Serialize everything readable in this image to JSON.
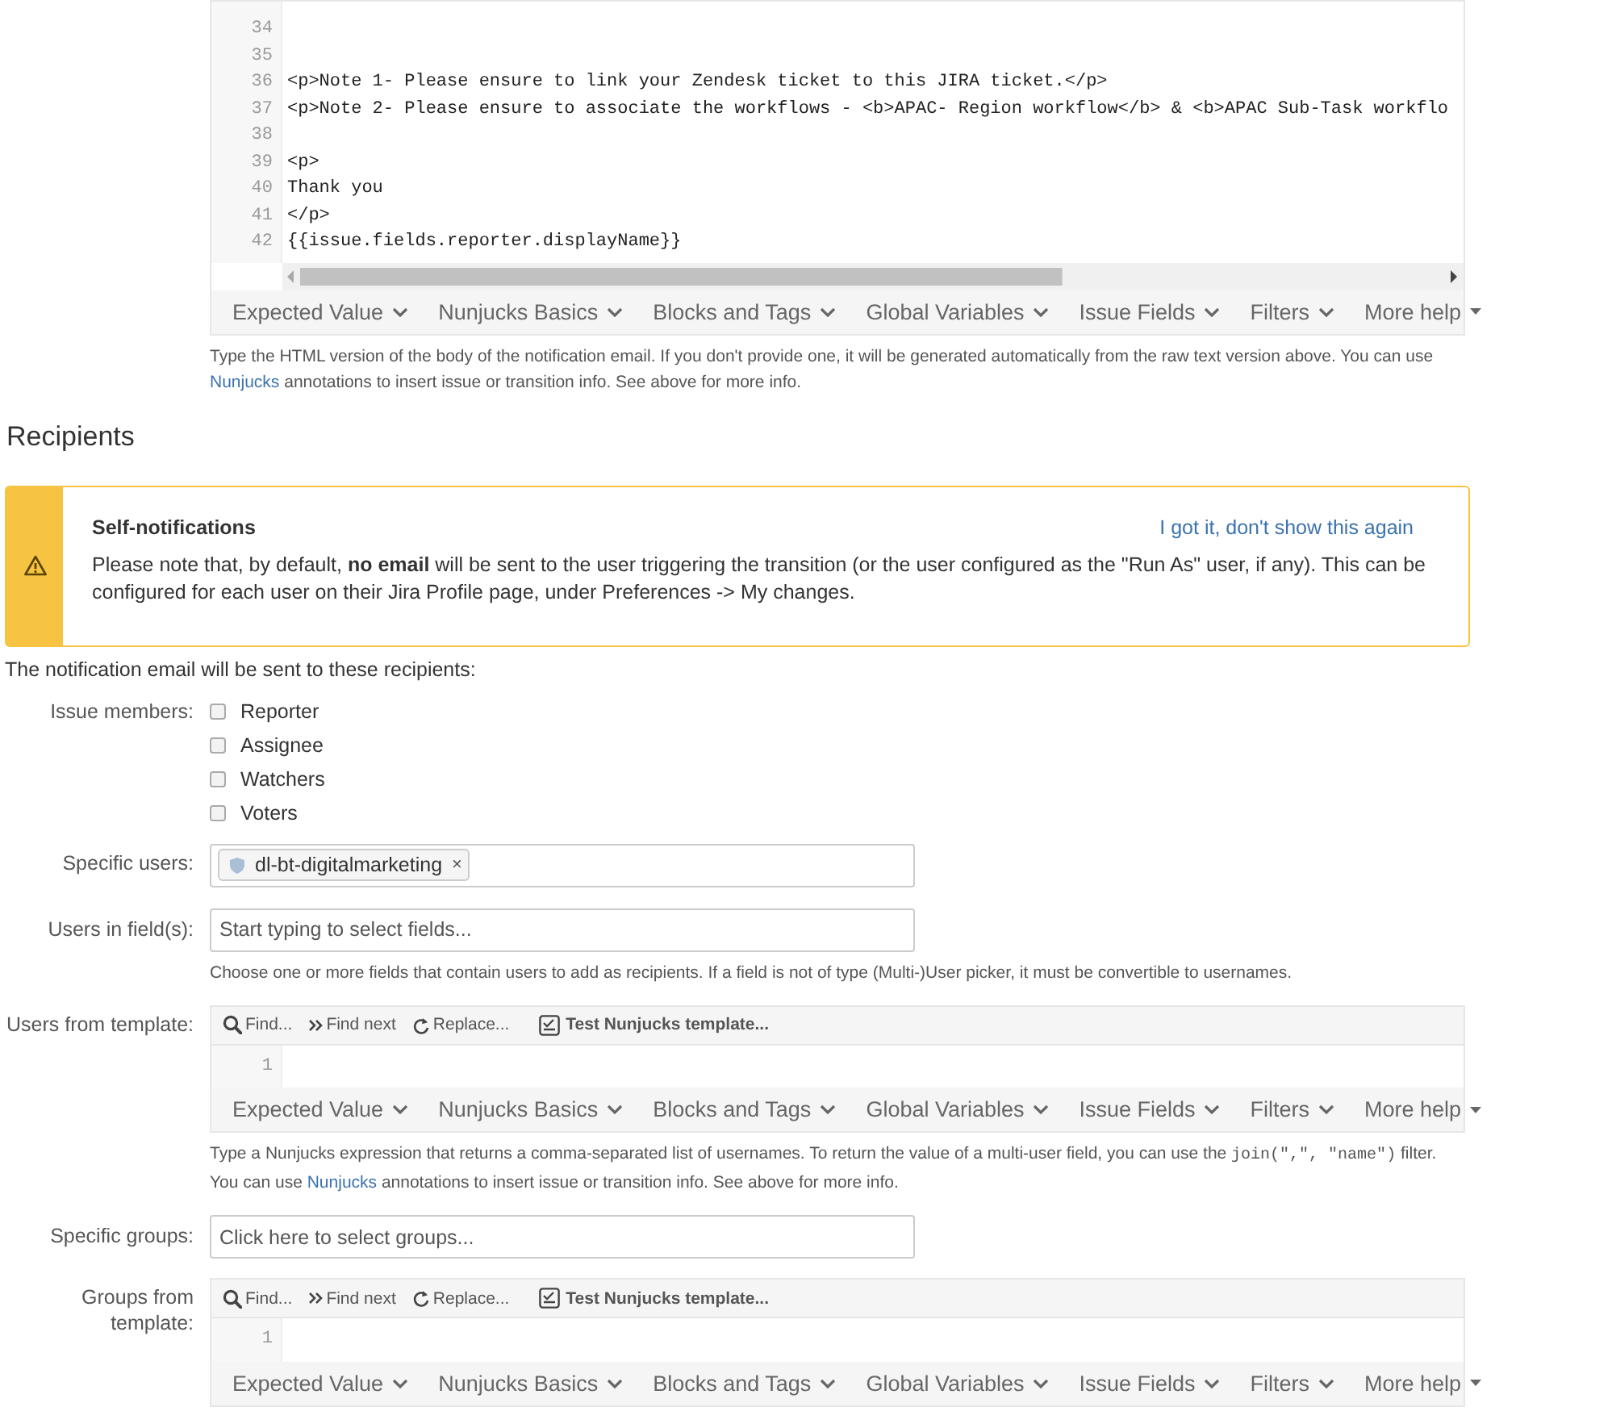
{
  "body_editor": {
    "lines": [
      {
        "number": "34"
      },
      {
        "number": "35"
      },
      {
        "number": "36",
        "code": "<p>Note 1- Please ensure to link your Zendesk ticket to this JIRA ticket.</p>"
      },
      {
        "number": "37",
        "code": "<p>Note 2- Please ensure to associate the workflows - <b>APAC- Region workflow</b> & <b>APAC Sub-Task workflo"
      },
      {
        "number": "38"
      },
      {
        "number": "39",
        "code": "<p>"
      },
      {
        "number": "40",
        "code": "Thank you"
      },
      {
        "number": "41",
        "code": "</p>"
      },
      {
        "number": "42",
        "code": "{{issue.fields.reporter.displayName}}"
      }
    ],
    "help_menu": [
      {
        "label": "Expected Value",
        "kind": "dropdown"
      },
      {
        "label": "Nunjucks Basics",
        "kind": "dropdown"
      },
      {
        "label": "Blocks and Tags",
        "kind": "dropdown"
      },
      {
        "label": "Global Variables",
        "kind": "dropdown"
      },
      {
        "label": "Issue Fields",
        "kind": "dropdown"
      },
      {
        "label": "Filters",
        "kind": "dropdown"
      },
      {
        "label": "More help",
        "kind": "menu"
      }
    ],
    "help_text": [
      {
        "kind": "text",
        "text": "Type the HTML version of the body of the notification email. If you don't provide one, it will be generated automatically from the raw text version above. You can use "
      },
      {
        "kind": "link",
        "text": "Nunjucks"
      },
      {
        "kind": "text",
        "text": " annotations to insert issue or transition info. See above for more info."
      }
    ]
  },
  "recipients": {
    "heading": "Recipients",
    "alert": {
      "title": "Self-notifications",
      "dismiss": "I got it, don't show this again",
      "text": "Please note that, by default, **no email** will be sent to the user triggering the transition (or the user configured as the \"Run As\" user, if any). This can be configured for each user on their Jira Profile page, under Preferences -> My changes."
    },
    "intro": "The notification email will be sent to these recipients:",
    "fields": [
      {
        "kind": "checkboxes",
        "label": "Issue members:",
        "options": [
          {
            "label": "Reporter",
            "checked": false
          },
          {
            "label": "Assignee",
            "checked": false
          },
          {
            "label": "Watchers",
            "checked": false
          },
          {
            "label": "Voters",
            "checked": false
          }
        ]
      },
      {
        "kind": "tags",
        "label": "Specific users:",
        "tags": [
          {
            "label": "dl-bt-digitalmarketing",
            "remove": "×"
          }
        ]
      },
      {
        "kind": "input",
        "label": "Users in field(s):",
        "placeholder": "Start typing to select fields...",
        "help": [
          {
            "kind": "text",
            "text": "Choose one or more fields that contain users to add as recipients. If a field is not of type (Multi-)User picker, it must be convertible to usernames."
          }
        ]
      },
      {
        "kind": "template",
        "label": "Users from template:",
        "toolbar": [
          {
            "label": "Find...",
            "kind": "find"
          },
          {
            "label": "Find next",
            "kind": "find_next"
          },
          {
            "label": "Replace...",
            "kind": "replace"
          },
          {
            "label": "Test Nunjucks template...",
            "kind": "test"
          }
        ],
        "lines": [
          "1"
        ],
        "help_menu": [
          {
            "label": "Expected Value",
            "kind": "dropdown"
          },
          {
            "label": "Nunjucks Basics",
            "kind": "dropdown"
          },
          {
            "label": "Blocks and Tags",
            "kind": "dropdown"
          },
          {
            "label": "Global Variables",
            "kind": "dropdown"
          },
          {
            "label": "Issue Fields",
            "kind": "dropdown"
          },
          {
            "label": "Filters",
            "kind": "dropdown"
          },
          {
            "label": "More help",
            "kind": "menu"
          }
        ],
        "help": [
          {
            "kind": "text",
            "text": "Type a Nunjucks expression that returns a comma-separated list of usernames. To return the value of a multi-user field, you can use the "
          },
          {
            "kind": "code",
            "text": "join(\",\", \"name\")"
          },
          {
            "kind": "text",
            "text": " filter. You can use "
          },
          {
            "kind": "link",
            "text": "Nunjucks"
          },
          {
            "kind": "text",
            "text": " annotations to insert issue or transition info. See above for more info."
          }
        ]
      },
      {
        "kind": "input",
        "label": "Specific groups:",
        "placeholder": "Click here to select groups..."
      },
      {
        "kind": "template",
        "label": "Groups from template:",
        "toolbar": [
          {
            "label": "Find...",
            "kind": "find"
          },
          {
            "label": "Find next",
            "kind": "find_next"
          },
          {
            "label": "Replace...",
            "kind": "replace"
          },
          {
            "label": "Test Nunjucks template...",
            "kind": "test"
          }
        ],
        "lines": [
          "1"
        ],
        "help_menu": [
          {
            "label": "Expected Value",
            "kind": "dropdown"
          },
          {
            "label": "Nunjucks Basics",
            "kind": "dropdown"
          },
          {
            "label": "Blocks and Tags",
            "kind": "dropdown"
          },
          {
            "label": "Global Variables",
            "kind": "dropdown"
          },
          {
            "label": "Issue Fields",
            "kind": "dropdown"
          },
          {
            "label": "Filters",
            "kind": "dropdown"
          },
          {
            "label": "More help",
            "kind": "menu"
          }
        ]
      }
    ]
  }
}
